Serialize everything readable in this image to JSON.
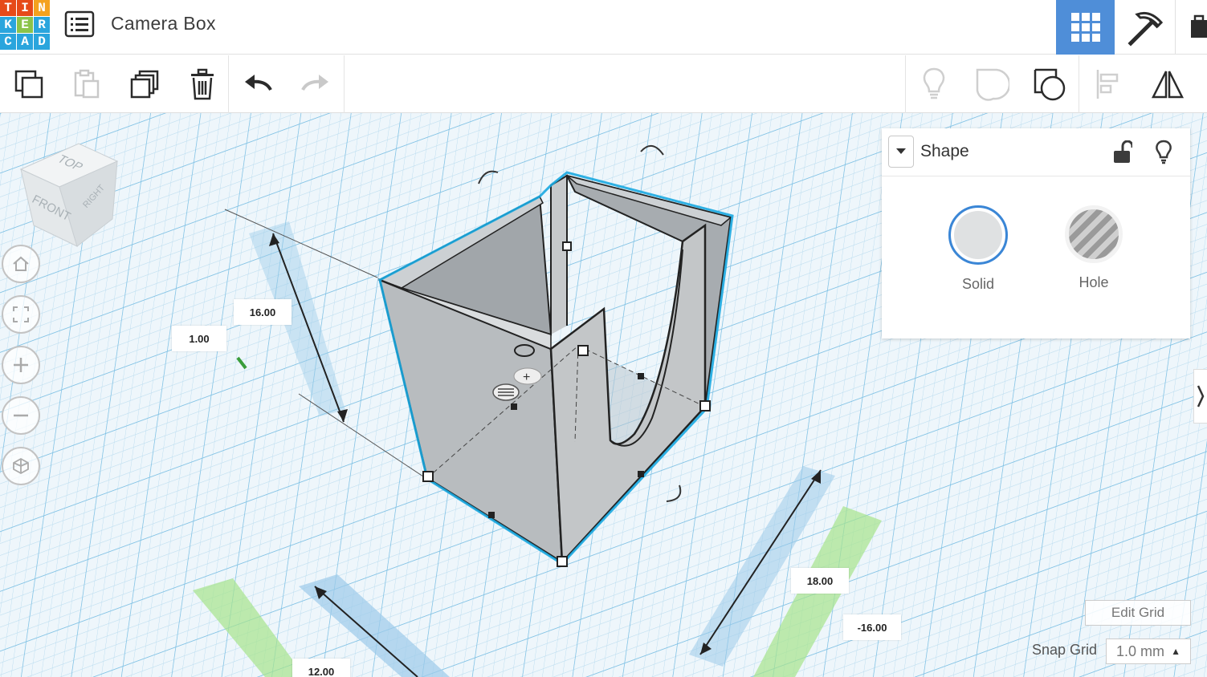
{
  "app": {
    "logo_letters": [
      "T",
      "I",
      "N",
      "K",
      "E",
      "R",
      "C",
      "A",
      "D"
    ],
    "logo_colors": [
      "#e64a19",
      "#e64a19",
      "#f4a21f",
      "#2aa5dd",
      "#8bc34a",
      "#2aa5dd",
      "#2aa5dd",
      "#2aa5dd",
      "#2aa5dd"
    ],
    "title": "Camera Box"
  },
  "header": {
    "active_view_color": "#4f8ed8",
    "icons": [
      "list-icon",
      "grid-icon",
      "pickaxe-icon",
      "briefcase-icon"
    ]
  },
  "toolbar": {
    "left_icons": [
      "copy-icon",
      "paste-icon",
      "duplicate-icon",
      "delete-icon",
      "undo-icon",
      "redo-icon"
    ],
    "right_icons": [
      "lightbulb-icon",
      "show-all-icon",
      "group-icon",
      "align-icon",
      "mirror-icon"
    ]
  },
  "viewcube": {
    "top": "TOP",
    "front": "FRONT",
    "right": "RIGHT"
  },
  "view_controls": [
    "home-icon",
    "fit-icon",
    "zoom-in-icon",
    "zoom-out-icon",
    "ortho-icon"
  ],
  "dimensions": {
    "height": "16.00",
    "elevation": "1.00",
    "width": "18.00",
    "length": "12.00",
    "offset": "-16.00"
  },
  "shape_panel": {
    "title": "Shape",
    "solid_label": "Solid",
    "hole_label": "Hole",
    "solid_color": "#dfe1e2",
    "selected_ring_color": "#3a86d6"
  },
  "grid": {
    "edit_label": "Edit Grid",
    "snap_label": "Snap Grid",
    "snap_value": "1.0 mm"
  },
  "colors": {
    "grid_line": "#a9d4ec",
    "workplane": "#e9f3f9",
    "selection_outline": "#1aa9e0",
    "object_fill": "#b5b9bc"
  }
}
